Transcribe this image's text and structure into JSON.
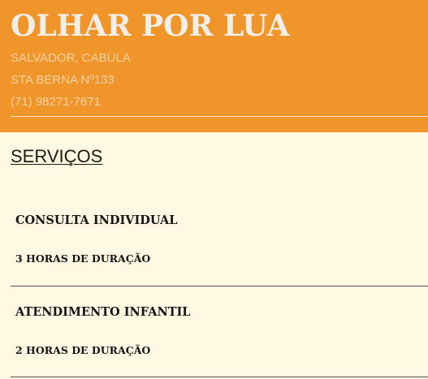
{
  "header": {
    "title": "OLHAR POR LUA",
    "address": "SALVADOR, CABULA",
    "street": "STA BERNA Nº133",
    "phone": "(71) 98271-7671"
  },
  "services": {
    "title": "SERVIÇOS",
    "items": [
      {
        "name": "CONSULTA INDIVIDUAL",
        "duration": "3 HORAS DE DURAÇÃO"
      },
      {
        "name": "ATENDIMENTO INFANTIL",
        "duration": "2 HORAS DE DURAÇÃO"
      }
    ]
  },
  "colors": {
    "header_background": "#ef952a",
    "page_background": "#fff8e2",
    "title_text": "#f3efe8",
    "header_info_text": "#f8d2a2",
    "body_text": "#151515"
  }
}
